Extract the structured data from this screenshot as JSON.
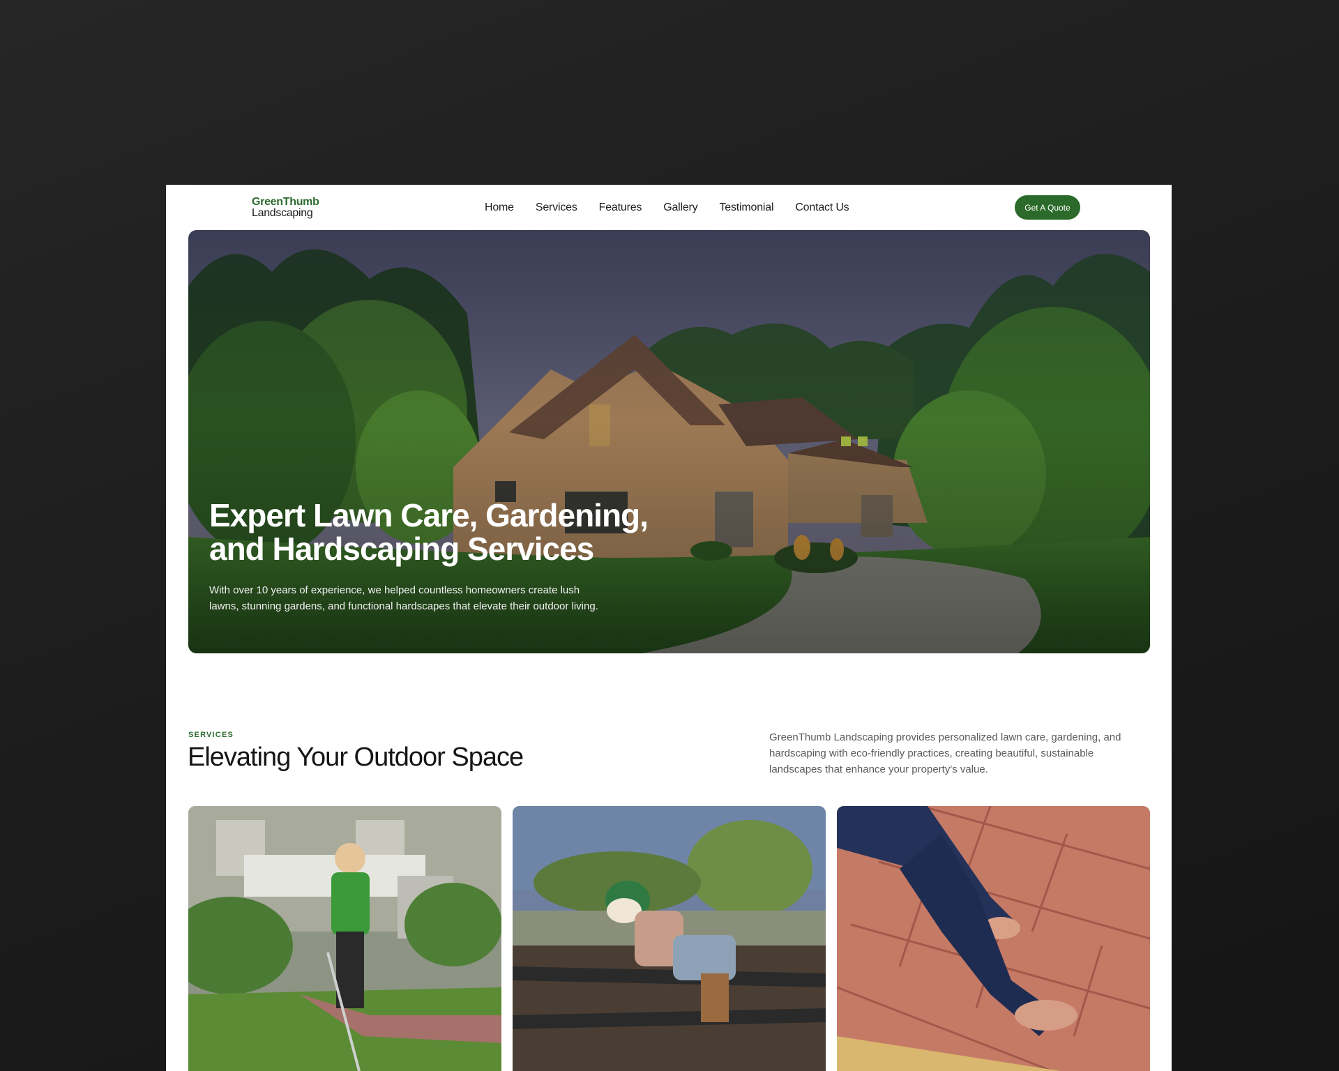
{
  "nav": {
    "logo_line1": "GreenThumb",
    "logo_line2": "Landscaping",
    "links": [
      "Home",
      "Services",
      "Features",
      "Gallery",
      "Testimonial",
      "Contact Us"
    ],
    "cta_label": "Get A Quote"
  },
  "hero": {
    "title_line1": "Expert Lawn Care, Gardening,",
    "title_line2": "and Hardscaping Services",
    "subtitle": "With over 10 years of experience, we helped countless homeowners create lush lawns, stunning gardens, and functional hardscapes that elevate their outdoor living."
  },
  "services": {
    "eyebrow": "SERVICES",
    "title": "Elevating Your Outdoor Space",
    "description": "GreenThumb Landscaping provides personalized lawn care, gardening, and hardscaping with eco-friendly practices, creating beautiful, sustainable landscapes that enhance your property's value."
  },
  "colors": {
    "brand_green": "#2b6a2a",
    "page_bg": "#1d1d1d"
  }
}
